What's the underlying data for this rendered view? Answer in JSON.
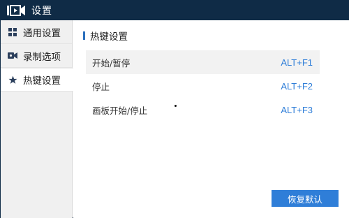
{
  "window": {
    "title": "设置"
  },
  "sidebar": {
    "items": [
      {
        "label": "通用设置",
        "icon": "grid-icon",
        "active": false
      },
      {
        "label": "录制选项",
        "icon": "video-camera-icon",
        "active": false
      },
      {
        "label": "热键设置",
        "icon": "star-icon",
        "active": true
      }
    ]
  },
  "main": {
    "section_title": "热键设置",
    "hotkeys": [
      {
        "name": "开始/暂停",
        "key": "ALT+F1"
      },
      {
        "name": "停止",
        "key": "ALT+F2"
      },
      {
        "name": "画板开始/停止",
        "key": "ALT+F3"
      }
    ],
    "ok_button": "恢复默认"
  },
  "colors": {
    "titlebar": "#0f2b46",
    "accent": "#2f7ed8",
    "sidebar_bg": "#f0f0f0"
  }
}
